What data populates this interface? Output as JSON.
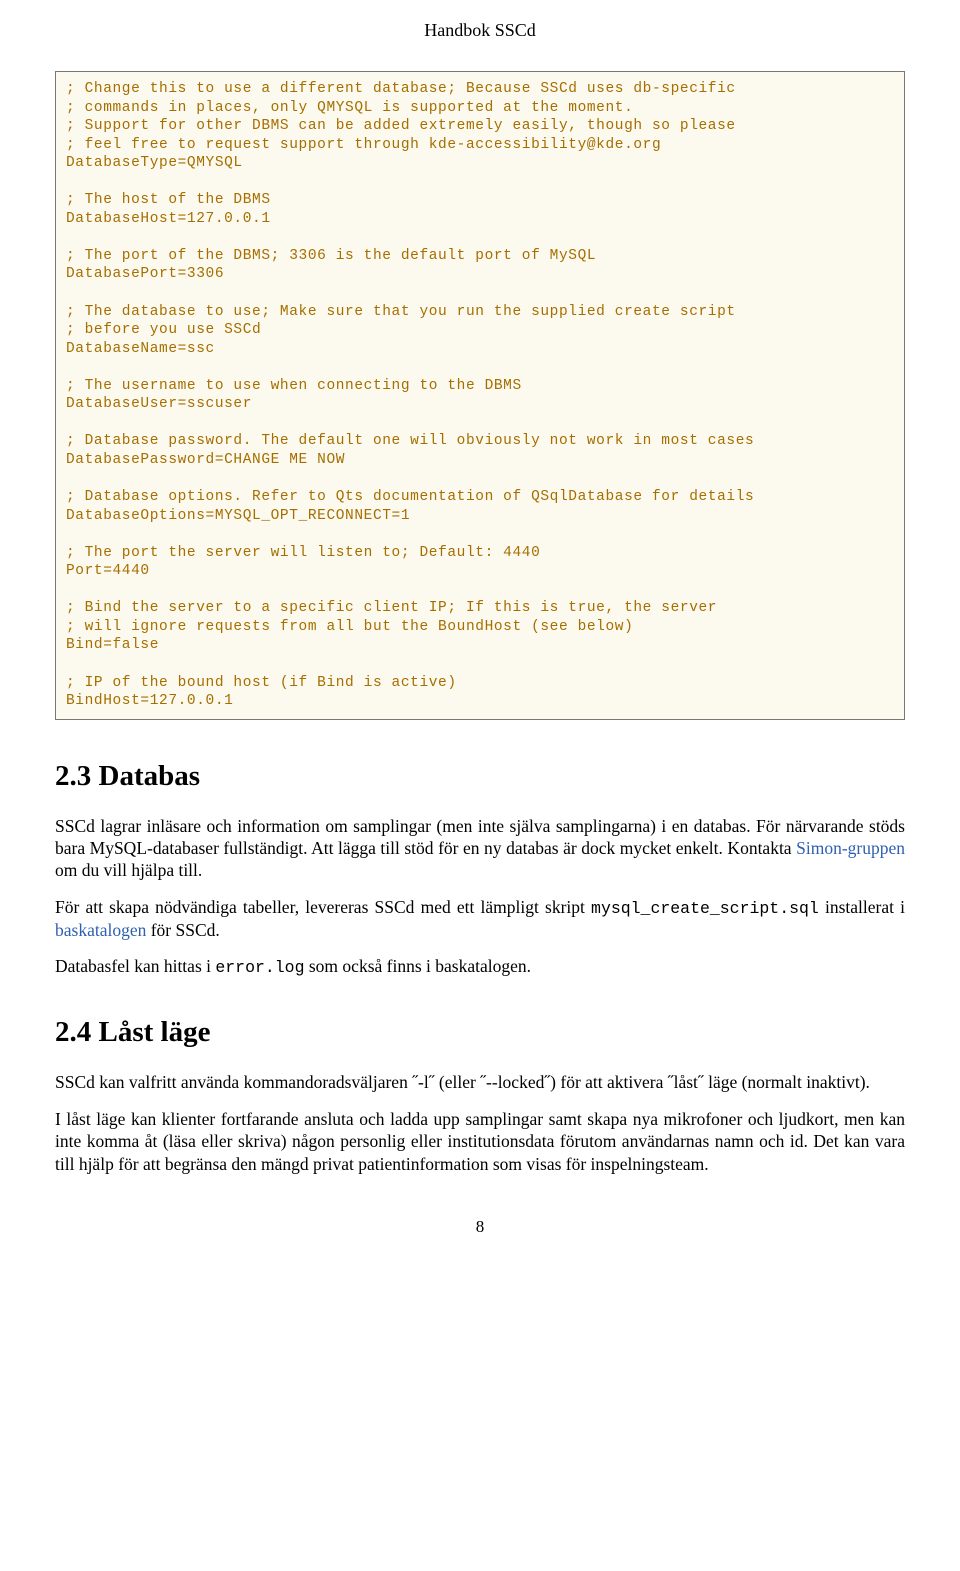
{
  "header": {
    "title": "Handbok SSCd"
  },
  "code": "; Change this to use a different database; Because SSCd uses db-specific\n; commands in places, only QMYSQL is supported at the moment.\n; Support for other DBMS can be added extremely easily, though so please\n; feel free to request support through kde-accessibility@kde.org\nDatabaseType=QMYSQL\n\n; The host of the DBMS\nDatabaseHost=127.0.0.1\n\n; The port of the DBMS; 3306 is the default port of MySQL\nDatabasePort=3306\n\n; The database to use; Make sure that you run the supplied create script\n; before you use SSCd\nDatabaseName=ssc\n\n; The username to use when connecting to the DBMS\nDatabaseUser=sscuser\n\n; Database password. The default one will obviously not work in most cases\nDatabasePassword=CHANGE ME NOW\n\n; Database options. Refer to Qts documentation of QSqlDatabase for details\nDatabaseOptions=MYSQL_OPT_RECONNECT=1\n\n; The port the server will listen to; Default: 4440\nPort=4440\n\n; Bind the server to a specific client IP; If this is true, the server\n; will ignore requests from all but the BoundHost (see below)\nBind=false\n\n; IP of the bound host (if Bind is active)\nBindHost=127.0.0.1",
  "section23": {
    "heading": "2.3   Databas",
    "p1a": "SSCd lagrar inläsare och information om samplingar (men inte själva samplingarna) i en databas. För närvarande stöds bara MySQL-databaser fullständigt. Att lägga till stöd för en ny databas är dock mycket enkelt. Kontakta ",
    "p1link": "Simon-gruppen",
    "p1b": " om du vill hjälpa till.",
    "p2a": "För att skapa nödvändiga tabeller, levereras SSCd med ett lämpligt skript ",
    "p2code1": "mysql_create_script",
    "p2dot": ".",
    "p2code2": "sql",
    "p2b": " installerat i ",
    "p2link": "baskatalogen",
    "p2c": " för SSCd.",
    "p3a": "Databasfel kan hittas i ",
    "p3code": "error.log",
    "p3b": " som också finns i baskatalogen."
  },
  "section24": {
    "heading": "2.4   Låst läge",
    "p1": "SSCd kan valfritt använda kommandoradsväljaren ˝-l˝ (eller ˝--locked˝) för att aktivera ˝låst˝ läge (normalt inaktivt).",
    "p2": "I låst läge kan klienter fortfarande ansluta och ladda upp samplingar samt skapa nya mikrofoner och ljudkort, men kan inte komma åt (läsa eller skriva) någon personlig eller institutionsdata förutom användarnas namn och id. Det kan vara till hjälp för att begränsa den mängd privat patientinformation som visas för inspelningsteam."
  },
  "pageNumber": "8"
}
